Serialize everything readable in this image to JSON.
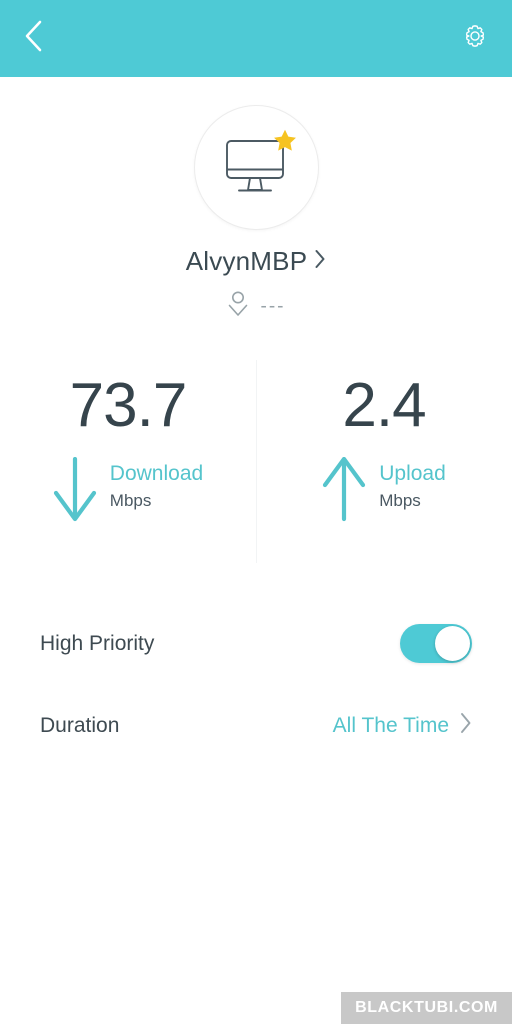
{
  "header": {
    "back_icon": "chevron-left-icon",
    "settings_icon": "gear-icon",
    "bg_color": "#4ecad5"
  },
  "device": {
    "icon": "desktop-monitor-icon",
    "badge_icon": "star-icon",
    "badge_color": "#f5c21b",
    "name": "AlvynMBP",
    "name_chevron": "chevron-right-icon",
    "owner_icon": "person-icon",
    "owner_name": "---"
  },
  "speeds": {
    "download": {
      "value": "73.7",
      "direction_label": "Download",
      "unit": "Mbps",
      "icon": "arrow-down-icon"
    },
    "upload": {
      "value": "2.4",
      "direction_label": "Upload",
      "unit": "Mbps",
      "icon": "arrow-up-icon"
    },
    "accent_color": "#55c4cc"
  },
  "settings": {
    "high_priority": {
      "label": "High Priority",
      "toggle_state": "on"
    },
    "duration": {
      "label": "Duration",
      "value": "All The Time",
      "chevron": "chevron-right-icon"
    }
  },
  "watermark": {
    "text": "BLACKTUBI.COM"
  }
}
